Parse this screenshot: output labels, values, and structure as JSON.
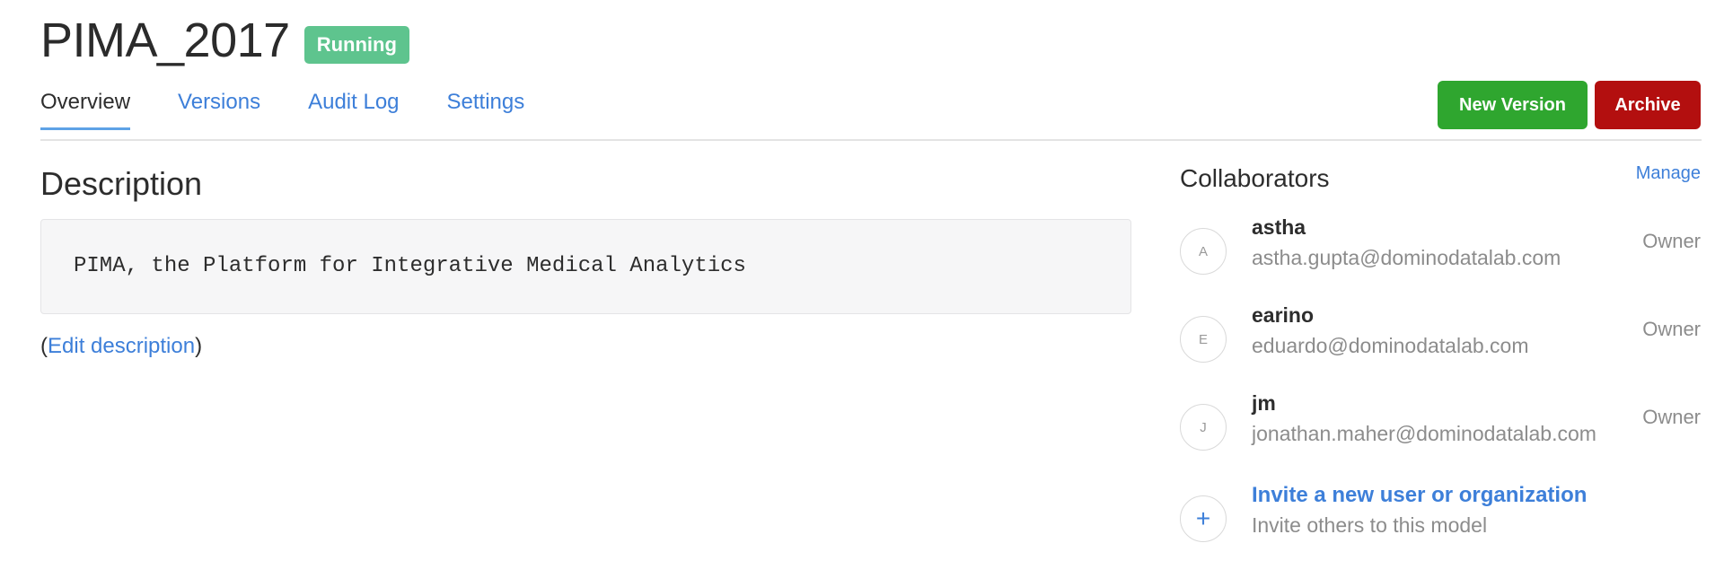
{
  "header": {
    "title": "PIMA_2017",
    "status": "Running",
    "status_color": "#5ec48e"
  },
  "tabs": [
    {
      "label": "Overview",
      "active": true
    },
    {
      "label": "Versions",
      "active": false
    },
    {
      "label": "Audit Log",
      "active": false
    },
    {
      "label": "Settings",
      "active": false
    }
  ],
  "actions": {
    "new_version_label": "New Version",
    "new_version_color": "#2fa62f",
    "archive_label": "Archive",
    "archive_color": "#b30f0f"
  },
  "description": {
    "heading": "Description",
    "text": "PIMA, the Platform for Integrative Medical Analytics",
    "edit_open": "(",
    "edit_label": "Edit description",
    "edit_close": ")"
  },
  "collaborators": {
    "heading": "Collaborators",
    "manage_label": "Manage",
    "items": [
      {
        "initial": "A",
        "name": "astha",
        "email": "astha.gupta@dominodatalab.com",
        "role": "Owner"
      },
      {
        "initial": "E",
        "name": "earino",
        "email": "eduardo@dominodatalab.com",
        "role": "Owner"
      },
      {
        "initial": "J",
        "name": "jm",
        "email": "jonathan.maher@dominodatalab.com",
        "role": "Owner"
      }
    ],
    "invite": {
      "icon": "plus-icon",
      "symbol": "+",
      "label": "Invite a new user or organization",
      "sublabel": "Invite others to this model"
    }
  }
}
